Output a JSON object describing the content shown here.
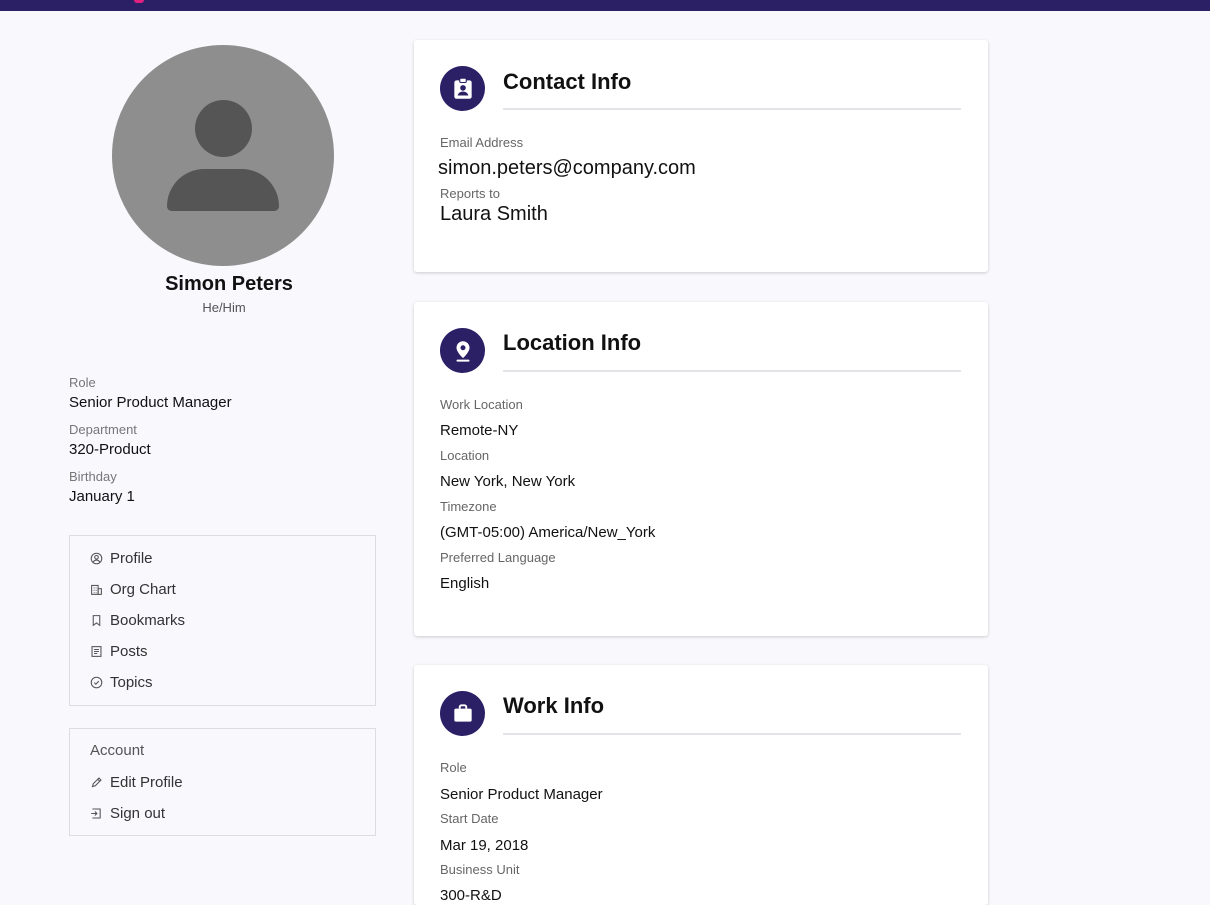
{
  "profile": {
    "name": "Simon Peters",
    "pronouns": "He/Him",
    "fields": [
      {
        "label": "Role",
        "value": "Senior Product Manager"
      },
      {
        "label": "Department",
        "value": "320-Product"
      },
      {
        "label": "Birthday",
        "value": "January 1"
      }
    ]
  },
  "nav": {
    "items": [
      {
        "label": "Profile",
        "icon": "user-circle-icon"
      },
      {
        "label": "Org Chart",
        "icon": "building-icon"
      },
      {
        "label": "Bookmarks",
        "icon": "bookmark-icon"
      },
      {
        "label": "Posts",
        "icon": "document-icon"
      },
      {
        "label": "Topics",
        "icon": "check-circle-icon"
      }
    ]
  },
  "account": {
    "header": "Account",
    "items": [
      {
        "label": "Edit Profile",
        "icon": "pencil-icon"
      },
      {
        "label": "Sign out",
        "icon": "sign-out-icon"
      }
    ]
  },
  "contact": {
    "title": "Contact Info",
    "icon": "id-badge-icon",
    "fields": [
      {
        "label": "Email Address",
        "value": "simon.peters@company.com"
      },
      {
        "label": "Reports to",
        "value": "Laura Smith"
      }
    ]
  },
  "location": {
    "title": "Location Info",
    "icon": "location-pin-icon",
    "fields": [
      {
        "label": "Work Location",
        "value": "Remote-NY"
      },
      {
        "label": "Location",
        "value": "New York, New York"
      },
      {
        "label": "Timezone",
        "value": "(GMT-05:00) America/New_York"
      },
      {
        "label": "Preferred Language",
        "value": "English"
      }
    ]
  },
  "work": {
    "title": "Work Info",
    "icon": "briefcase-icon",
    "fields": [
      {
        "label": "Role",
        "value": "Senior Product Manager"
      },
      {
        "label": "Start Date",
        "value": "Mar 19, 2018"
      },
      {
        "label": "Business Unit",
        "value": "300-R&D"
      }
    ]
  },
  "colors": {
    "topbar": "#2b1f66",
    "accent": "#e0217f",
    "icon_bg": "#2b1f66"
  }
}
